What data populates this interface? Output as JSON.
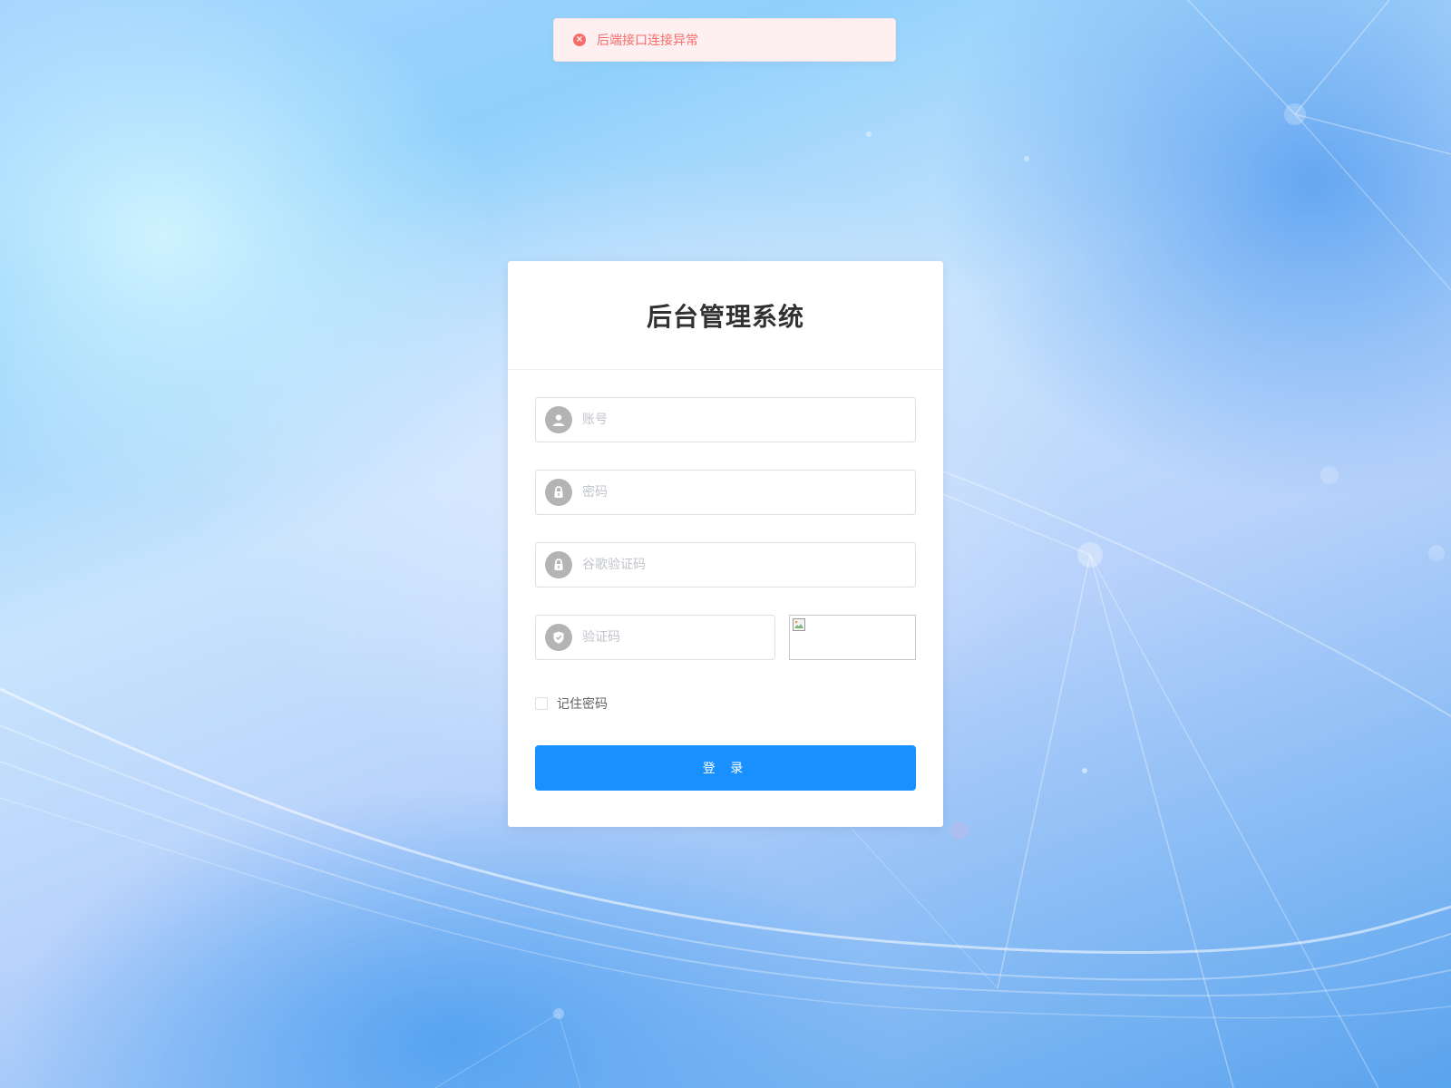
{
  "toast": {
    "message": "后端接口连接异常",
    "icon": "error-circle-icon",
    "color": "#f56c6c"
  },
  "login": {
    "title": "后台管理系统",
    "username_placeholder": "账号",
    "password_placeholder": "密码",
    "google_code_placeholder": "谷歌验证码",
    "captcha_placeholder": "验证码",
    "remember_label": "记住密码",
    "submit_label": "登 录",
    "accent_color": "#1890ff"
  },
  "icons": {
    "username": "user-icon",
    "password": "lock-icon",
    "google_code": "lock-icon",
    "captcha": "shield-check-icon",
    "captcha_image": "broken-image-icon"
  }
}
